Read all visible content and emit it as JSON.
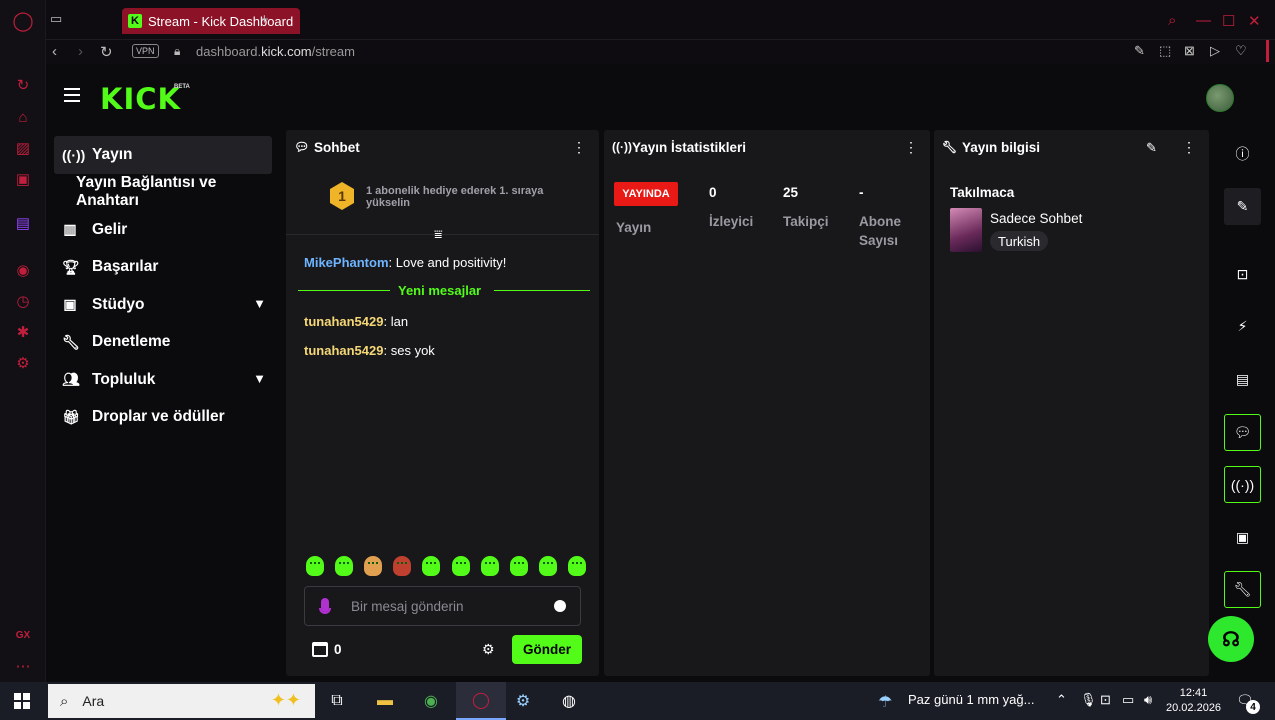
{
  "browser": {
    "tab_title": "Stream - Kick Dashboard",
    "vpn_label": "VPN",
    "url_host_prefix": "dashboard.",
    "url_host_main": "kick.com",
    "url_path": "/stream"
  },
  "header": {
    "logo": "KICK",
    "beta": "BETA"
  },
  "nav": {
    "items": [
      {
        "label": "Yayın"
      },
      {
        "label": "Yayın Bağlantısı ve Anahtarı"
      },
      {
        "label": "Gelir"
      },
      {
        "label": "Başarılar"
      },
      {
        "label": "Stüdyo"
      },
      {
        "label": "Denetleme"
      },
      {
        "label": "Topluluk"
      },
      {
        "label": "Droplar ve ödüller"
      }
    ]
  },
  "chat": {
    "title": "Sohbet",
    "gift_rank": "1",
    "gift_text": "1 abonelik hediye ederek 1. sıraya yükselin",
    "messages": [
      {
        "user": "MikePhantom",
        "text": " Love and positivity!",
        "color": "#6eb4ff"
      },
      {
        "user": "tunahan5429",
        "text": " lan",
        "color": "#f5d776"
      },
      {
        "user": "tunahan5429",
        "text": " ses yok",
        "color": "#f5d776"
      }
    ],
    "new_messages_label": "Yeni mesajlar",
    "input_placeholder": "Bir mesaj gönderin",
    "points": "0",
    "send_label": "Gönder"
  },
  "stats": {
    "title": "Yayın İstatistikleri",
    "live_badge": "YAYINDA",
    "stream_label": "Yayın",
    "viewers_value": "0",
    "viewers_label": "İzleyici",
    "followers_value": "25",
    "followers_label": "Takipçi",
    "subs_value": "-",
    "subs_label_1": "Abone",
    "subs_label_2": "Sayısı"
  },
  "info": {
    "title": "Yayın bilgisi",
    "section": "Takılmaca",
    "category": "Sadece Sohbet",
    "tag": "Turkish"
  },
  "taskbar": {
    "search_placeholder": "Ara",
    "weather": "Paz günü 1 mm yağ...",
    "time": "12:41",
    "date": "20.02.2026",
    "notifications": "4"
  },
  "colors": {
    "kick_green": "#53fc18",
    "live_red": "#e91916",
    "opera_red": "#c01e3c"
  }
}
